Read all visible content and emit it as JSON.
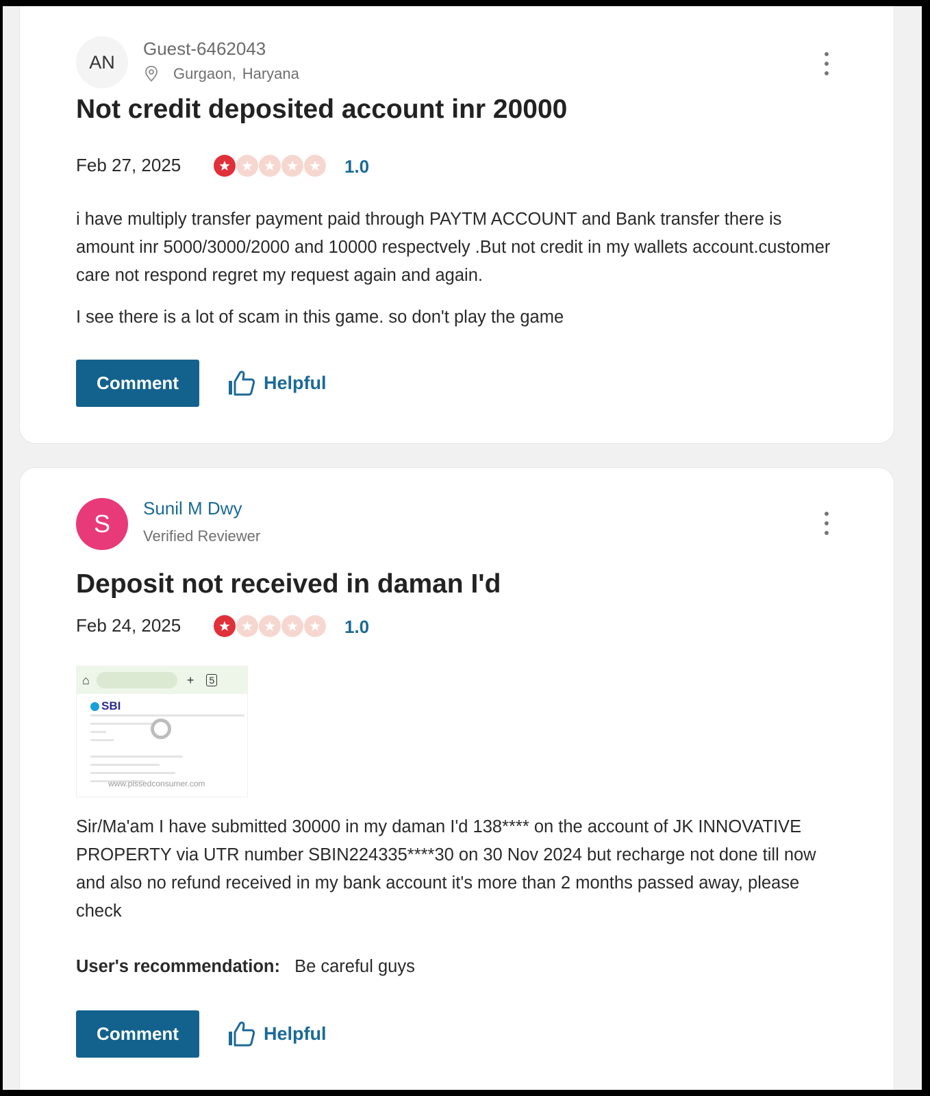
{
  "colors": {
    "accent": "#13628e",
    "link": "#1b6a96",
    "star_active": "#e0303a",
    "star_inactive": "#f6d7cf",
    "avatar_user_bg": "#e83a78"
  },
  "reviews": [
    {
      "author": {
        "initials": "AN",
        "name": "Guest-6462043",
        "city": "Gurgaon,",
        "state": "Haryana"
      },
      "title": "Not credit deposited account inr 20000",
      "date": "Feb 27, 2025",
      "rating": "1.0",
      "rating_value": 1,
      "rating_max": 5,
      "paragraphs": [
        "i have multiply transfer payment paid through PAYTM ACCOUNT and Bank transfer there is amount inr 5000/3000/2000 and 10000 respectvely .But not credit in my wallets account.customer care not respond regret my request again and again.",
        "I see there is a lot of scam in this game. so don't play the game"
      ],
      "comment_label": "Comment",
      "helpful_label": "Helpful"
    },
    {
      "author": {
        "initials": "S",
        "name": "Sunil M Dwy",
        "badge": "Verified Reviewer"
      },
      "title": "Deposit not received in daman I'd",
      "date": "Feb 24, 2025",
      "rating": "1.0",
      "rating_value": 1,
      "rating_max": 5,
      "attachment": {
        "bank_logo": "SBI",
        "watermark": "www.pissedconsumer.com"
      },
      "paragraphs": [
        "Sir/Ma'am I have submitted 30000 in my daman I'd 138**** on the account of JK INNOVATIVE PROPERTY via UTR number SBIN224335****30 on 30 Nov 2024 but recharge not done till now and also no refund received in my bank account it's more than 2 months passed away, please check"
      ],
      "recommendation_label": "User's recommendation:",
      "recommendation": "Be careful guys",
      "comment_label": "Comment",
      "helpful_label": "Helpful"
    }
  ]
}
